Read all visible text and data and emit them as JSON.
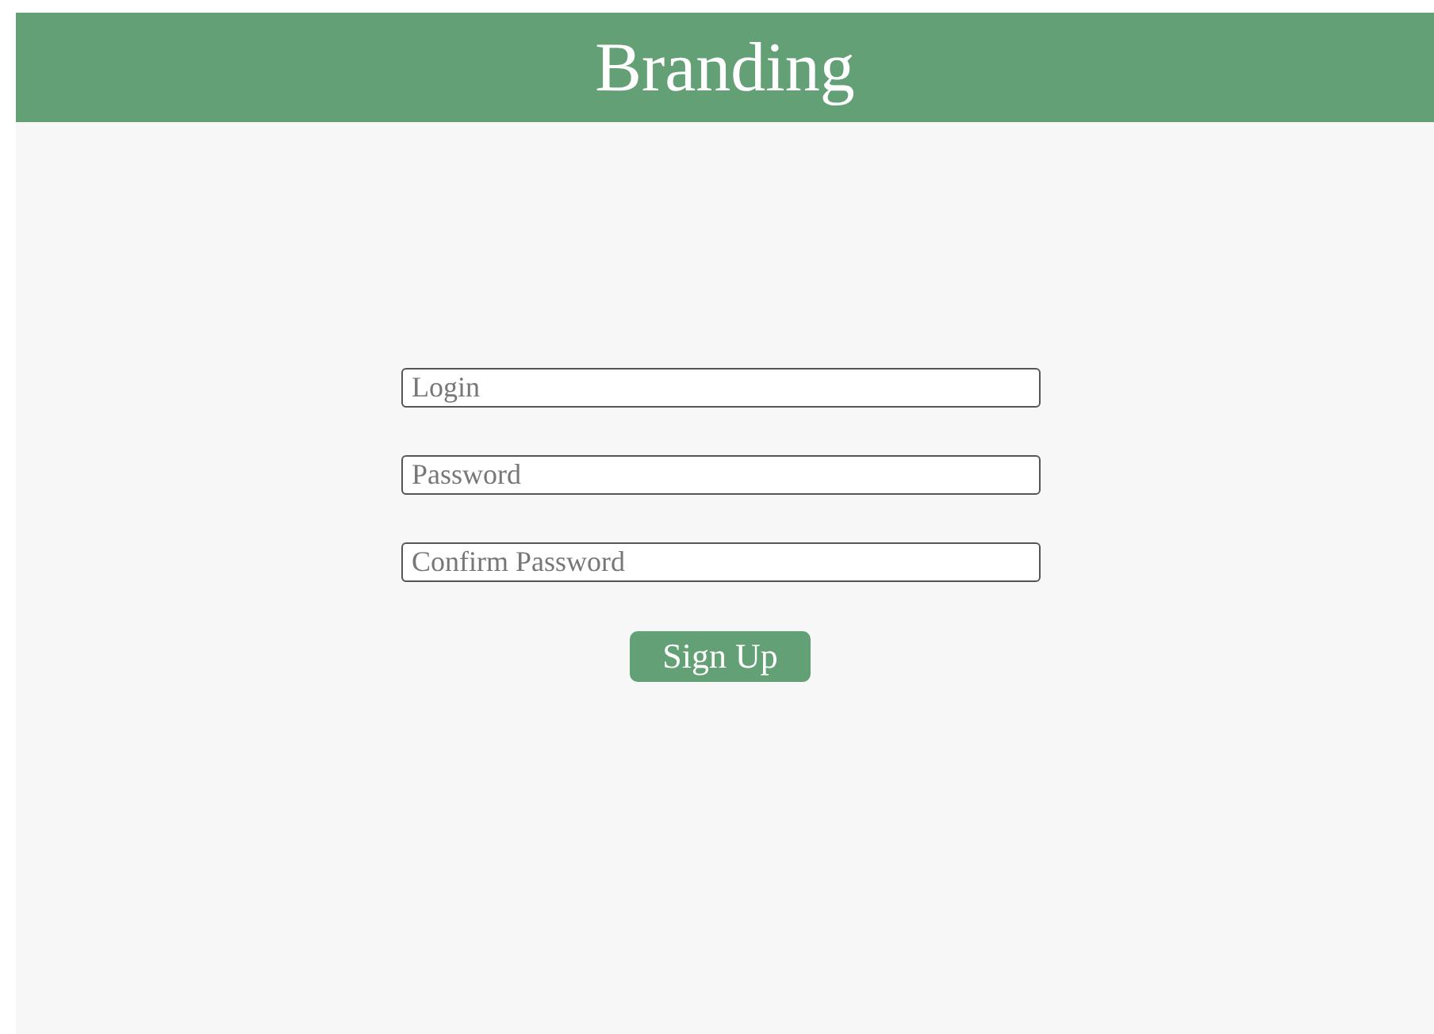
{
  "header": {
    "title": "Branding"
  },
  "fields": [
    {
      "placeholder": "Login"
    },
    {
      "placeholder": "Password"
    },
    {
      "placeholder": "Confirm Password"
    }
  ],
  "button": {
    "label": "Sign Up"
  }
}
